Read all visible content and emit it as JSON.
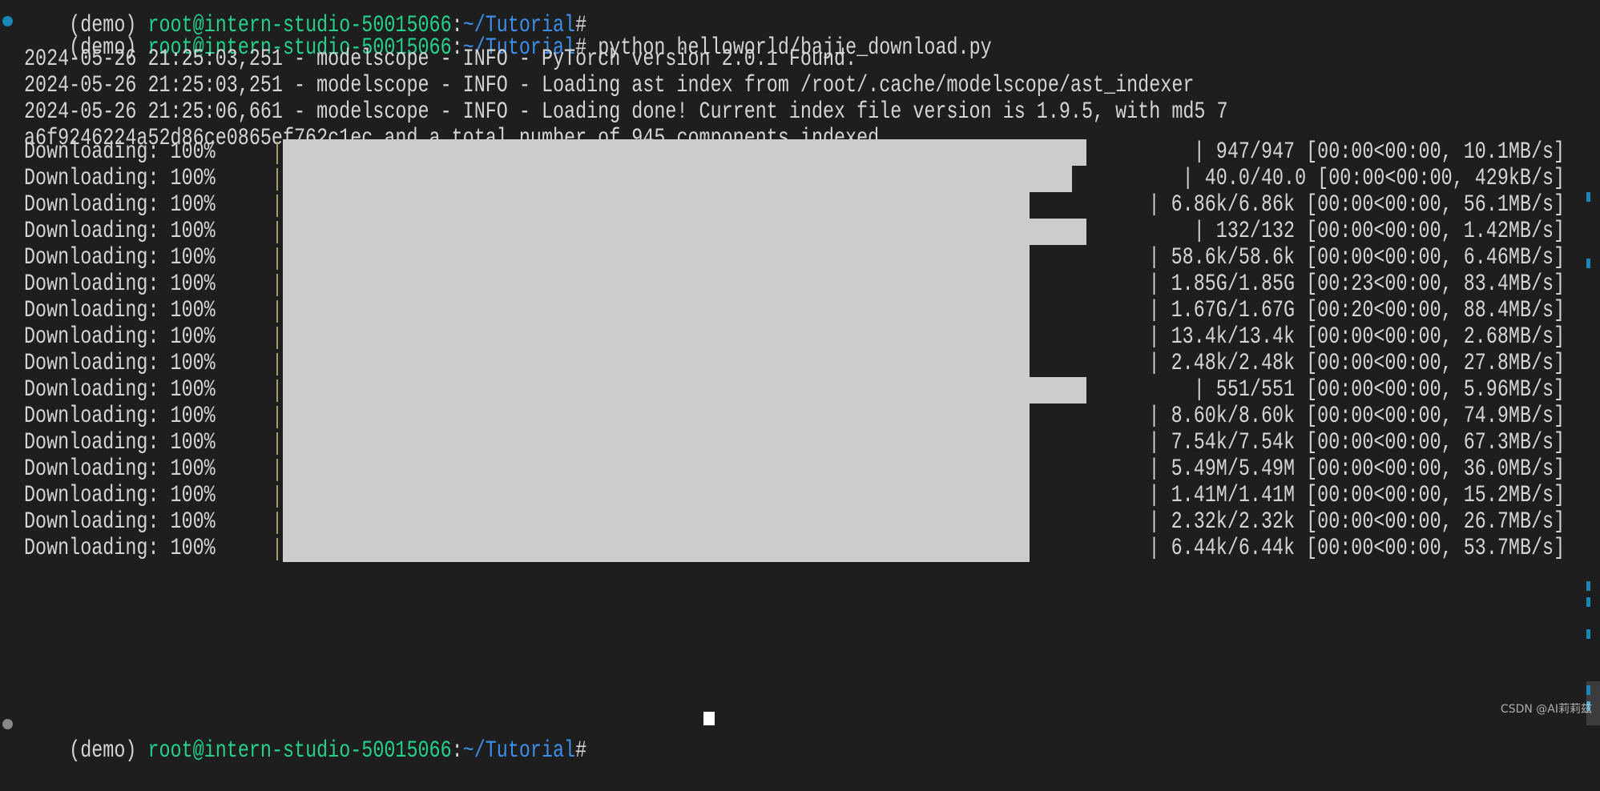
{
  "terminal": {
    "prev_prompt": {
      "env": "(demo) ",
      "user_host": "root@intern-studio-50015066",
      "colon": ":",
      "path": "~/Tutorial",
      "hash": "#"
    },
    "prompt": {
      "env": "(demo) ",
      "user_host": "root@intern-studio-50015066",
      "colon": ":",
      "path": "~/Tutorial",
      "hash": "# ",
      "command": "python helloworld/bajie_download.py"
    },
    "log_lines": [
      "2024-05-26 21:25:03,251 - modelscope - INFO - PyTorch version 2.0.1 Found.",
      "2024-05-26 21:25:03,251 - modelscope - INFO - Loading ast index from /root/.cache/modelscope/ast_indexer",
      "2024-05-26 21:25:06,661 - modelscope - INFO - Loading done! Current index file version is 1.9.5, with md5 7",
      "a6f9246224a52d86ce0865ef762c1ec and a total number of 945 components indexed"
    ],
    "downloads": [
      {
        "label": "Downloading: 100%",
        "progress": 100,
        "stats": "| 947/947 [00:00<00:00, 10.1MB/s]"
      },
      {
        "label": "Downloading: 100%",
        "progress": 100,
        "stats": "| 40.0/40.0 [00:00<00:00, 429kB/s]"
      },
      {
        "label": "Downloading: 100%",
        "progress": 100,
        "stats": "| 6.86k/6.86k [00:00<00:00, 56.1MB/s]"
      },
      {
        "label": "Downloading: 100%",
        "progress": 100,
        "stats": "| 132/132 [00:00<00:00, 1.42MB/s]"
      },
      {
        "label": "Downloading: 100%",
        "progress": 100,
        "stats": "| 58.6k/58.6k [00:00<00:00, 6.46MB/s]"
      },
      {
        "label": "Downloading: 100%",
        "progress": 100,
        "stats": "| 1.85G/1.85G [00:23<00:00, 83.4MB/s]"
      },
      {
        "label": "Downloading: 100%",
        "progress": 100,
        "stats": "| 1.67G/1.67G [00:20<00:00, 88.4MB/s]"
      },
      {
        "label": "Downloading: 100%",
        "progress": 100,
        "stats": "| 13.4k/13.4k [00:00<00:00, 2.68MB/s]"
      },
      {
        "label": "Downloading: 100%",
        "progress": 100,
        "stats": "| 2.48k/2.48k [00:00<00:00, 27.8MB/s]"
      },
      {
        "label": "Downloading: 100%",
        "progress": 100,
        "stats": "| 551/551 [00:00<00:00, 5.96MB/s]"
      },
      {
        "label": "Downloading: 100%",
        "progress": 100,
        "stats": "| 8.60k/8.60k [00:00<00:00, 74.9MB/s]"
      },
      {
        "label": "Downloading: 100%",
        "progress": 100,
        "stats": "| 7.54k/7.54k [00:00<00:00, 67.3MB/s]"
      },
      {
        "label": "Downloading: 100%",
        "progress": 100,
        "stats": "| 5.49M/5.49M [00:00<00:00, 36.0MB/s]"
      },
      {
        "label": "Downloading: 100%",
        "progress": 100,
        "stats": "| 1.41M/1.41M [00:00<00:00, 15.2MB/s]"
      },
      {
        "label": "Downloading: 100%",
        "progress": 100,
        "stats": "| 2.32k/2.32k [00:00<00:00, 26.7MB/s]"
      },
      {
        "label": "Downloading: 100%",
        "progress": 100,
        "stats": "| 6.44k/6.44k [00:00<00:00, 53.7MB/s]"
      }
    ],
    "next_prompt": {
      "env": "(demo) ",
      "user_host": "root@intern-studio-50015066",
      "colon": ":",
      "path": "~/Tutorial",
      "hash": "#"
    }
  },
  "colors": {
    "background": "#1e1e1e",
    "text": "#d4d4d4",
    "user_host": "#23d18b",
    "path": "#3b8eea",
    "bar": "#cccccc",
    "marker": "#1a85b8"
  },
  "watermark": "CSDN @AI莉莉兹"
}
